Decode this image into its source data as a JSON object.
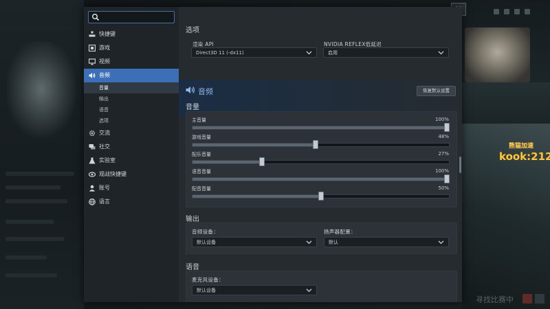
{
  "background": {
    "watermark": {
      "top": "熊猫加速",
      "main": "kook:212"
    },
    "close_glyph": "✕",
    "bottom_text": "寻找比赛中"
  },
  "sidebar": {
    "search_placeholder": "",
    "items": [
      {
        "label": "快捷键",
        "icon": "hotkey-icon"
      },
      {
        "label": "游戏",
        "icon": "game-icon"
      },
      {
        "label": "视频",
        "icon": "monitor-icon"
      },
      {
        "label": "音频",
        "icon": "speaker-icon",
        "active": true
      },
      {
        "label": "交流",
        "icon": "gear-icon"
      },
      {
        "label": "社交",
        "icon": "chat-icon"
      },
      {
        "label": "实验室",
        "icon": "flask-icon"
      },
      {
        "label": "观战快捷键",
        "icon": "eye-icon"
      },
      {
        "label": "账号",
        "icon": "user-icon"
      },
      {
        "label": "语言",
        "icon": "globe-icon"
      }
    ],
    "sub_items": [
      {
        "label": "音量",
        "active": true
      },
      {
        "label": "输出"
      },
      {
        "label": "语音"
      },
      {
        "label": "选项"
      }
    ]
  },
  "options": {
    "section_title": "选项",
    "render_api": {
      "label": "渲染 API",
      "value": "Direct3D 11 (-dx11)"
    },
    "reflex": {
      "label": "NVIDIA REFLEX低延迟",
      "value": "启用"
    }
  },
  "audio": {
    "title": "音频",
    "reset_label": "恢复默认设置",
    "volume_title": "音量",
    "sliders": [
      {
        "label": "主音量",
        "value": 100,
        "display": "100%"
      },
      {
        "label": "游戏音量",
        "value": 48,
        "display": "48%"
      },
      {
        "label": "配乐音量",
        "value": 27,
        "display": "27%"
      },
      {
        "label": "语音音量",
        "value": 100,
        "display": "100%"
      },
      {
        "label": "配音音量",
        "value": 50,
        "display": "50%"
      }
    ],
    "output_title": "输出",
    "audio_device": {
      "label": "音频设备：",
      "value": "默认设备"
    },
    "speaker_config": {
      "label": "扬声器配置：",
      "value": "默认"
    },
    "voice_title": "语音",
    "mic_device": {
      "label": "麦克风设备：",
      "value": "默认设备"
    }
  },
  "colors": {
    "accent": "#3d6fb6",
    "audio_title": "#8db6ea",
    "watermark": "#f4c94b"
  }
}
